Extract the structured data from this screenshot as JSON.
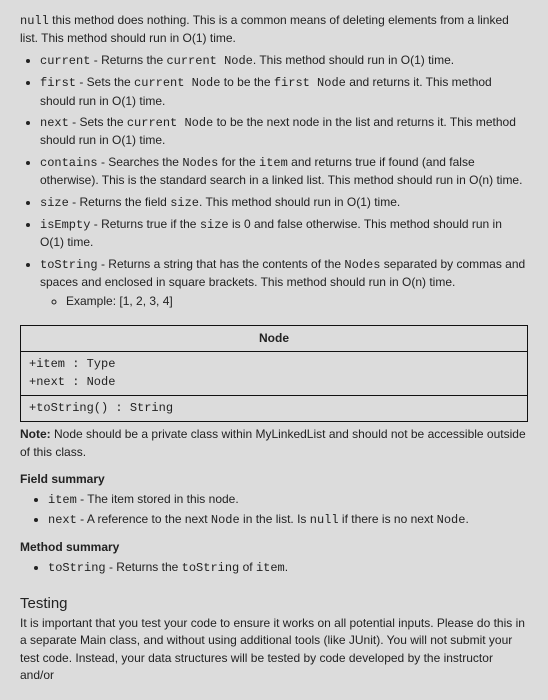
{
  "intro": {
    "pre": "null",
    "post": " this method does nothing. This is a common means of deleting elements from a linked list. This method should run in O(1) time."
  },
  "methods": [
    {
      "name": "current",
      "sep": " - Returns the ",
      "m1": "current Node",
      "post": ". This method should run in O(1) time."
    },
    {
      "name": "first",
      "sep": " - Sets the ",
      "m1": "current Node",
      "mid": " to be the ",
      "m2": "first Node",
      "post": " and returns it. This method should run in O(1) time."
    },
    {
      "name": "next",
      "sep": " - Sets the ",
      "m1": "current Node",
      "mid": " to be the next node in the list and returns it. This method should run in O(1) time."
    },
    {
      "name": "contains",
      "sep": " - Searches the ",
      "m1": "Nodes",
      "mid": " for the ",
      "m2": "item",
      "post": " and returns true if found (and false otherwise). This is the standard search in a linked list. This method should run in O(n) time."
    },
    {
      "name": "size",
      "sep": " - Returns the field ",
      "m1": "size",
      "post": ". This method should run in O(1) time."
    },
    {
      "name": "isEmpty",
      "sep": " - Returns true if the ",
      "m1": "size",
      "post": " is 0 and false otherwise. This method should run in O(1) time."
    },
    {
      "name": "toString",
      "sep": " - Returns a string that has the contents of the ",
      "m1": "Nodes",
      "post": " separated by commas and spaces and enclosed in square brackets. This method should run in O(n) time."
    }
  ],
  "example_label": "Example: [1, 2, 3, 4]",
  "node_header": "Node",
  "node_row1": "+item : Type\n+next : Node",
  "node_row2": "+toString() : String",
  "note_bold": "Note:",
  "note_text": " Node should be a private class within MyLinkedList and should not be accessible outside of this class.",
  "field_summary_head": "Field summary",
  "fields": [
    {
      "name": "item",
      "text": " - The item stored in this node."
    },
    {
      "name": "next",
      "pre": " - A reference to the next ",
      "m1": "Node",
      "mid": " in the list. Is ",
      "m2": "null",
      "mid2": " if there is no next ",
      "m3": "Node",
      "post": "."
    }
  ],
  "method_summary_head": "Method summary",
  "method_items": [
    {
      "name": "toString",
      "pre": " - Returns the ",
      "m1": "toString",
      "mid": " of ",
      "m2": "item",
      "post": "."
    }
  ],
  "testing_head": "Testing",
  "testing_text": "It is important that you test your code to ensure it works on all potential inputs. Please do this in a separate Main class, and without using additional tools (like JUnit). You will not submit your test code. Instead, your data structures will be tested by code developed by the instructor and/or"
}
